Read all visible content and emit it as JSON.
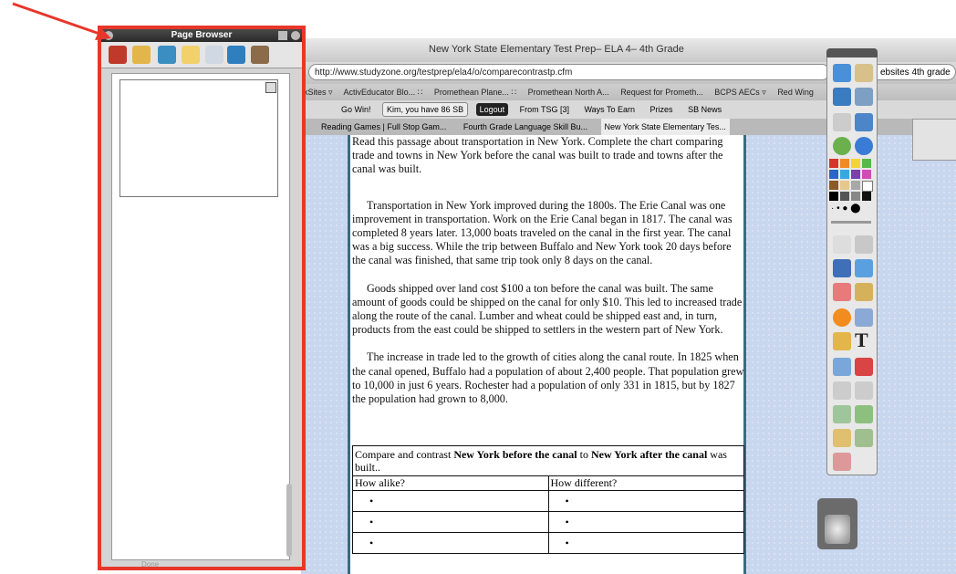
{
  "browser": {
    "title": "New York State Elementary Test Prep– ELA 4– 4th Grade",
    "url": "http://www.studyzone.org/testprep/ela4/o/comparecontrastp.cfm",
    "search": "ebsites 4th grade",
    "bookmarks": [
      "rkSites ▿",
      "ActivEducator Blo... ∷",
      "Promethean Plane... ∷",
      "Promethean North A...",
      "Request for Prometh...",
      "BCPS AECs ▿",
      "Red Wing"
    ],
    "addons": {
      "gowin": "Go Win!",
      "kim": "Kim, you have 86 SB",
      "logout": "Logout",
      "tsg": "From TSG [3]",
      "ways": "Ways To Earn",
      "prizes": "Prizes",
      "sbnews": "SB News"
    },
    "tabs": [
      "Reading Games | Full Stop Gam...",
      "Fourth Grade Language Skill Bu...",
      "New York State Elementary Tes..."
    ]
  },
  "panel": {
    "title": "Page Browser",
    "status": "Done"
  },
  "document": {
    "intro": "Read this passage about transportation in New York.  Complete the chart comparing trade and towns in New York before the canal was built to trade and towns after the canal was built.",
    "p1": "Transportation in New York improved during the 1800s.  The Erie Canal was one improvement in transportation.  Work on the Erie Canal began in 1817.  The canal was completed 8 years later.  13,000 boats traveled on the canal in the first year.  The canal was a big success.  While the trip between Buffalo and New York took 20 days before the canal was finished, that same trip took only 8 days on the canal.",
    "p2": "Goods shipped over land cost $100 a ton before the canal was built.  The same amount of goods could be shipped on the canal for only $10.  This led to increased trade along the route of the canal.  Lumber and wheat could be shipped east and, in turn, products from the east could be shipped to settlers in the western part of New York.",
    "p3": "The increase in trade led to the growth of cities along the canal route.  In 1825 when the canal opened, Buffalo had a population of about 2,400 people.  That population grew to 10,000 in just 6 years.  Rochester had a population of only 331 in 1815, but by 1827 the population had grown to 8,000.",
    "compare": {
      "prefix": "Compare and contrast ",
      "before": "New York before the canal",
      "mid": " to ",
      "after": "New York after the canal",
      "suffix": " was built..",
      "col1": "How alike?",
      "col2": "How different?",
      "bullet": "•"
    }
  },
  "colors": {
    "highlight_border": "#e8362a",
    "canvas": "#c8d6ee"
  }
}
